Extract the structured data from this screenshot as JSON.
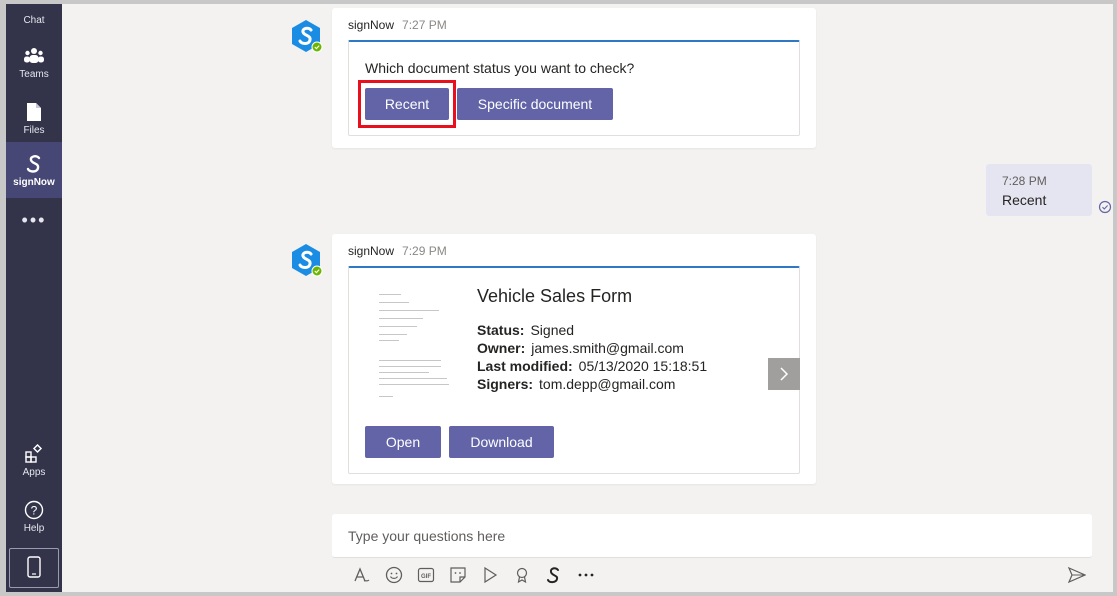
{
  "rail": {
    "chat_label": "Chat",
    "teams_label": "Teams",
    "files_label": "Files",
    "signnow_label": "signNow",
    "more_label": "•••",
    "apps_label": "Apps",
    "help_label": "Help",
    "active_color": "#464775",
    "background_color": "#33344a"
  },
  "messages": [
    {
      "sender": "signNow",
      "time": "7:27 PM",
      "question": "Which document status you want to check?",
      "buttons": [
        "Recent",
        "Specific document"
      ],
      "highlighted_button": "Recent"
    },
    {
      "reply_time": "7:28 PM",
      "reply_text": "Recent"
    },
    {
      "sender": "signNow",
      "time": "7:29 PM",
      "doc_title": "Vehicle Sales Form",
      "fields": [
        {
          "label": "Status:",
          "value": "Signed"
        },
        {
          "label": "Owner:",
          "value": "james.smith@gmail.com"
        },
        {
          "label": "Last modified:",
          "value": "05/13/2020 15:18:51"
        },
        {
          "label": "Signers:",
          "value": "tom.depp@gmail.com"
        }
      ],
      "buttons": [
        "Open",
        "Download"
      ]
    }
  ],
  "composer": {
    "placeholder": "Type your questions here"
  },
  "toolbar_icons": [
    "format-icon",
    "emoji-icon",
    "gif-icon",
    "sticker-icon",
    "meet-icon",
    "praise-icon",
    "signnow-icon",
    "more-icon"
  ],
  "colors": {
    "accent": "#6264a7",
    "card_border": "#2f78c4",
    "highlight": "#e8101d"
  }
}
